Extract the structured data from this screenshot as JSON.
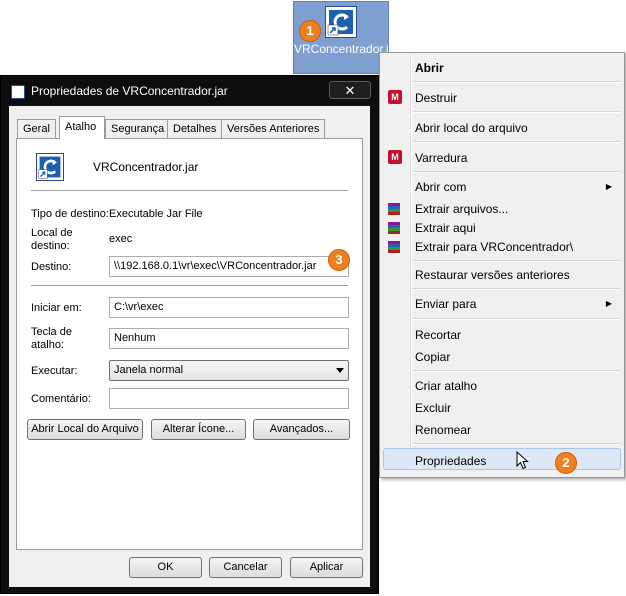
{
  "desktop_icon": {
    "label": "VRConcentrador.jar"
  },
  "badges": {
    "b1": "1",
    "b2": "2",
    "b3": "3"
  },
  "context_menu": {
    "items": {
      "abrir": "Abrir",
      "destruir": "Destruir",
      "abrir_local": "Abrir local do arquivo",
      "varredura": "Varredura",
      "abrir_com": "Abrir com",
      "extrair_arquivos": "Extrair arquivos...",
      "extrair_aqui": "Extrair aqui",
      "extrair_para": "Extrair para VRConcentrador\\",
      "restaurar": "Restaurar versões anteriores",
      "enviar_para": "Enviar para",
      "recortar": "Recortar",
      "copiar": "Copiar",
      "criar_atalho": "Criar atalho",
      "excluir": "Excluir",
      "renomear": "Renomear",
      "propriedades": "Propriedades"
    },
    "hovered_item": "Propriedades"
  },
  "properties_window": {
    "title": "Propriedades de VRConcentrador.jar",
    "close_label": "✕",
    "tabs": [
      "Geral",
      "Atalho",
      "Segurança",
      "Detalhes",
      "Versões Anteriores"
    ],
    "active_tab": "Atalho",
    "file_name": "VRConcentrador.jar",
    "tipo_label": "Tipo de destino:",
    "tipo_value": "Executable Jar File",
    "local_label_1": "Local de",
    "local_label_2": "destino:",
    "local_value": "exec",
    "destino_label": "Destino:",
    "destino_value": "\\\\192.168.0.1\\vr\\exec\\VRConcentrador.jar",
    "iniciar_label": "Iniciar em:",
    "iniciar_value": "C:\\vr\\exec",
    "tecla_label_1": "Tecla de",
    "tecla_label_2": "atalho:",
    "tecla_value": "Nenhum",
    "executar_label": "Executar:",
    "executar_value": "Janela normal",
    "comentario_label": "Comentário:",
    "comentario_value": "",
    "buttons": {
      "abrir_local": "Abrir Local do Arquivo",
      "alterar_icone": "Alterar Ícone...",
      "avancados": "Avançados...",
      "ok": "OK",
      "cancelar": "Cancelar",
      "aplicar": "Aplicar"
    }
  },
  "colors": {
    "badge": "#f07f21",
    "title_bar": "#0d0d0d",
    "icon_selection": "#7f9fd0",
    "menu_hover": "#dde8f7",
    "mcafee": "#c8102e"
  }
}
